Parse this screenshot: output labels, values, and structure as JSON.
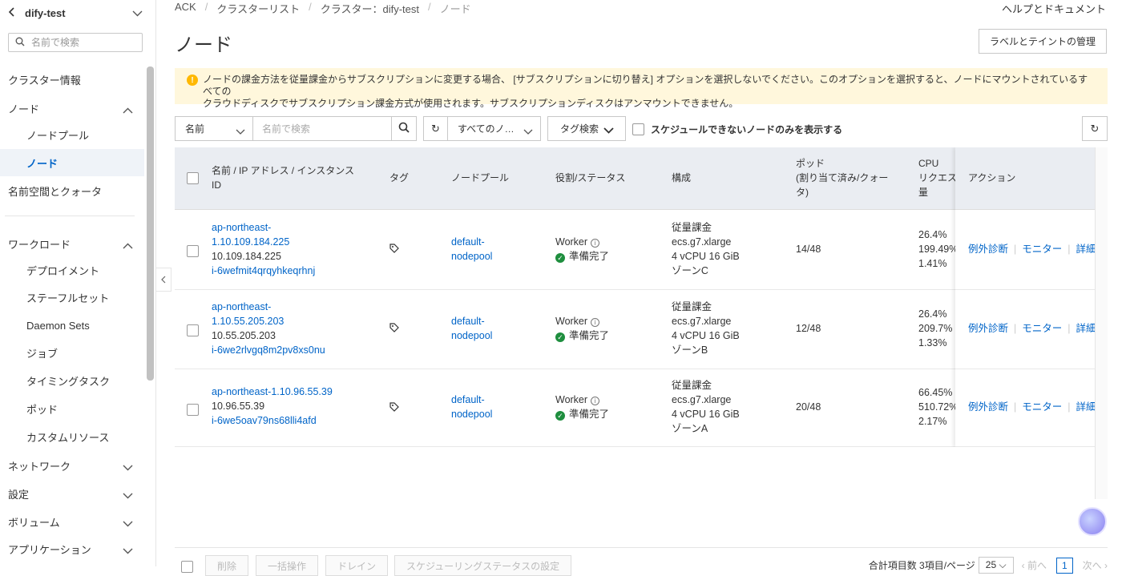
{
  "sidebar": {
    "cluster_name": "dify-test",
    "search_placeholder": "名前で検索",
    "items": [
      {
        "label": "クラスター情報"
      },
      {
        "label": "ノード"
      },
      {
        "label": "ノードプール"
      },
      {
        "label": "ノード"
      },
      {
        "label": "名前空間とクォータ"
      },
      {
        "label": "ワークロード"
      },
      {
        "label": "デプロイメント"
      },
      {
        "label": "ステーフルセット"
      },
      {
        "label": "Daemon Sets"
      },
      {
        "label": "ジョブ"
      },
      {
        "label": "タイミングタスク"
      },
      {
        "label": "ポッド"
      },
      {
        "label": "カスタムリソース"
      },
      {
        "label": "ネットワーク"
      },
      {
        "label": "設定"
      },
      {
        "label": "ボリューム"
      },
      {
        "label": "アプリケーション"
      }
    ]
  },
  "breadcrumb": {
    "items": [
      "ACK",
      "クラスターリスト",
      "クラスター：dify-test",
      "ノード"
    ]
  },
  "help_link": "ヘルプとドキュメント",
  "page_title": "ノード",
  "label_taint_button": "ラベルとテイントの管理",
  "notice": {
    "line1": "ノードの課金方法を従量課金からサブスクリプションに変更する場合、 [サブスクリプションに切り替え] オプションを選択しないでください。このオプションを選択すると、ノードにマウントされているすべての",
    "line2": "クラウドディスクでサブスクリプション課金方式が使用されます。サブスクリプションディスクはアンマウントできません。"
  },
  "toolbar": {
    "filter_select": "名前",
    "search_placeholder": "名前で検索",
    "nodepool_select": "すべてのノ…",
    "tag_search": "タグ検索",
    "unschedulable_only": "スケジュールできないノードのみを表示する"
  },
  "table": {
    "headers": {
      "name_line1": "名前 / IP アドレス / インスタンス",
      "name_line2": "ID",
      "tag": "タグ",
      "nodepool": "ノードプール",
      "role_status": "役割/ステータス",
      "config": "構成",
      "pods_line1": "ポッド",
      "pods_line2": "(割り当て済み/クォー",
      "pods_line3": "タ)",
      "cpu_line1": "CPU",
      "cpu_line2": "リクエス",
      "cpu_line3": "量",
      "actions": "アクション"
    },
    "rows": [
      {
        "name_line1": "ap-northeast-",
        "name_line2": "1.10.109.184.225",
        "ip": "10.109.184.225",
        "instance_id": "i-6wefmit4qrqyhkeqrhnj",
        "nodepool_line1": "default-",
        "nodepool_line2": "nodepool",
        "role": "Worker",
        "status": "準備完了",
        "billing": "従量課金",
        "instance_type": "ecs.g7.xlarge",
        "spec": "4 vCPU 16 GiB",
        "zone": "ゾーンC",
        "pods": "14/48",
        "cpu1": "26.4%",
        "cpu2": "199.49%",
        "cpu3": "1.41%"
      },
      {
        "name_line1": "ap-northeast-",
        "name_line2": "1.10.55.205.203",
        "ip": "10.55.205.203",
        "instance_id": "i-6we2rlvgq8m2pv8xs0nu",
        "nodepool_line1": "default-",
        "nodepool_line2": "nodepool",
        "role": "Worker",
        "status": "準備完了",
        "billing": "従量課金",
        "instance_type": "ecs.g7.xlarge",
        "spec": "4 vCPU 16 GiB",
        "zone": "ゾーンB",
        "pods": "12/48",
        "cpu1": "26.4%",
        "cpu2": "209.7%",
        "cpu3": "1.33%"
      },
      {
        "name_line1": "ap-northeast-1.10.96.55.39",
        "name_line2": "",
        "ip": "10.96.55.39",
        "instance_id": "i-6we5oav79ns68lli4afd",
        "nodepool_line1": "default-",
        "nodepool_line2": "nodepool",
        "role": "Worker",
        "status": "準備完了",
        "billing": "従量課金",
        "instance_type": "ecs.g7.xlarge",
        "spec": "4 vCPU 16 GiB",
        "zone": "ゾーンA",
        "pods": "20/48",
        "cpu1": "66.45%",
        "cpu2": "510.72%",
        "cpu3": "2.17%"
      }
    ],
    "actions": {
      "diagnose": "例外診断",
      "monitor": "モニター",
      "details": "詳細"
    }
  },
  "bottom_bar": {
    "delete": "削除",
    "batch": "一括操作",
    "drain": "ドレイン",
    "schedule": "スケジューリングステータスの設定",
    "total": "合計項目数 3項目/ページ",
    "page_size": "25",
    "prev": "前へ",
    "page": "1",
    "next": "次へ"
  }
}
